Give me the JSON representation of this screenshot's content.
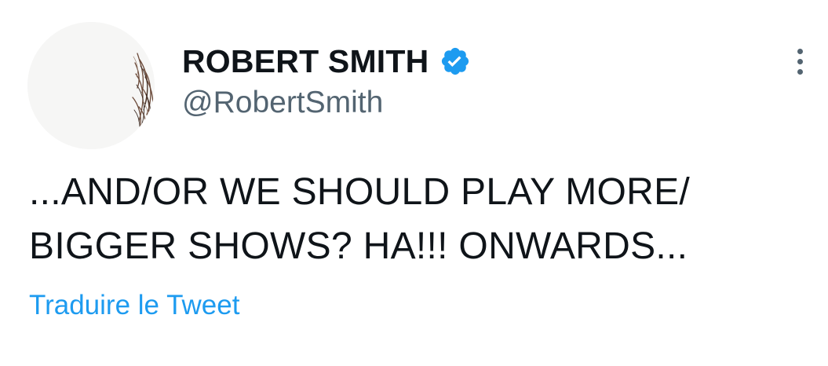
{
  "tweet": {
    "author": {
      "display_name": "ROBERT SMITH",
      "handle": "@RobertSmith",
      "verified": true,
      "verified_icon": "verified-badge-icon",
      "avatar_icon": "avatar"
    },
    "text_lines": [
      "...AND/OR WE SHOULD PLAY MORE/",
      "BIGGER SHOWS? HA!!! ONWARDS..."
    ],
    "translate_label": "Traduire le Tweet",
    "more_icon": "more-options-icon"
  },
  "colors": {
    "text_primary": "#0f1419",
    "text_secondary": "#536471",
    "link_blue": "#1d9bf0",
    "verified_blue": "#1d9bf0",
    "background": "#ffffff"
  }
}
